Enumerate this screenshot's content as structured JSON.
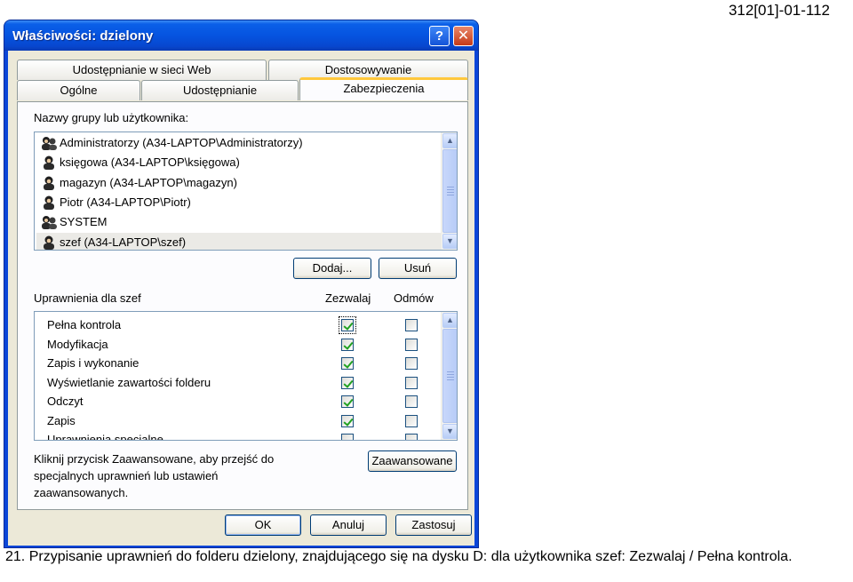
{
  "document": {
    "code": "312[01]-01-112"
  },
  "window": {
    "title": "Właściwości: dzielony",
    "help_label": "?",
    "close_label": "✕"
  },
  "tabs": [
    {
      "label": "Udostępnianie w sieci Web"
    },
    {
      "label": "Dostosowywanie"
    },
    {
      "label": "Ogólne"
    },
    {
      "label": "Udostępnianie"
    },
    {
      "label": "Zabezpieczenia"
    }
  ],
  "groups": {
    "label": "Nazwy grupy lub użytkownika:",
    "items": [
      {
        "name": "Administratorzy (A34-LAPTOP\\Administratorzy)",
        "icon": "group-icon"
      },
      {
        "name": "księgowa (A34-LAPTOP\\księgowa)",
        "icon": "user-icon"
      },
      {
        "name": "magazyn (A34-LAPTOP\\magazyn)",
        "icon": "user-icon"
      },
      {
        "name": "Piotr (A34-LAPTOP\\Piotr)",
        "icon": "user-icon"
      },
      {
        "name": "SYSTEM",
        "icon": "group-icon"
      },
      {
        "name": "szef (A34-LAPTOP\\szef)",
        "icon": "user-icon",
        "selected": true
      }
    ],
    "add_button": "Dodaj...",
    "remove_button": "Usuń"
  },
  "permissions": {
    "label": "Uprawnienia dla szef",
    "allow_header": "Zezwalaj",
    "deny_header": "Odmów",
    "rows": [
      {
        "name": "Pełna kontrola",
        "allow": true,
        "deny": false
      },
      {
        "name": "Modyfikacja",
        "allow": true,
        "deny": false
      },
      {
        "name": "Zapis i wykonanie",
        "allow": true,
        "deny": false
      },
      {
        "name": "Wyświetlanie zawartości folderu",
        "allow": true,
        "deny": false
      },
      {
        "name": "Odczyt",
        "allow": true,
        "deny": false
      },
      {
        "name": "Zapis",
        "allow": true,
        "deny": false
      },
      {
        "name": "Uprawnienia specjalne",
        "allow": false,
        "deny": false
      }
    ]
  },
  "advanced": {
    "info_line1": "Kliknij przycisk Zaawansowane, aby przejść do",
    "info_line2": "specjalnych uprawnień lub ustawień",
    "info_line3": "zaawansowanych.",
    "button": "Zaawansowane"
  },
  "footer": {
    "ok": "OK",
    "cancel": "Anuluj",
    "apply": "Zastosuj"
  },
  "caption": "21. Przypisanie uprawnień do folderu dzielony, znajdującego się na dysku D: dla użytkownika szef: Zezwalaj / Pełna kontrola.",
  "colors": {
    "titlebar": "#0654e0",
    "dialog_bg": "#ece9d8",
    "checkmark": "#21a121",
    "active_tab_accent": "#ffc83c"
  }
}
